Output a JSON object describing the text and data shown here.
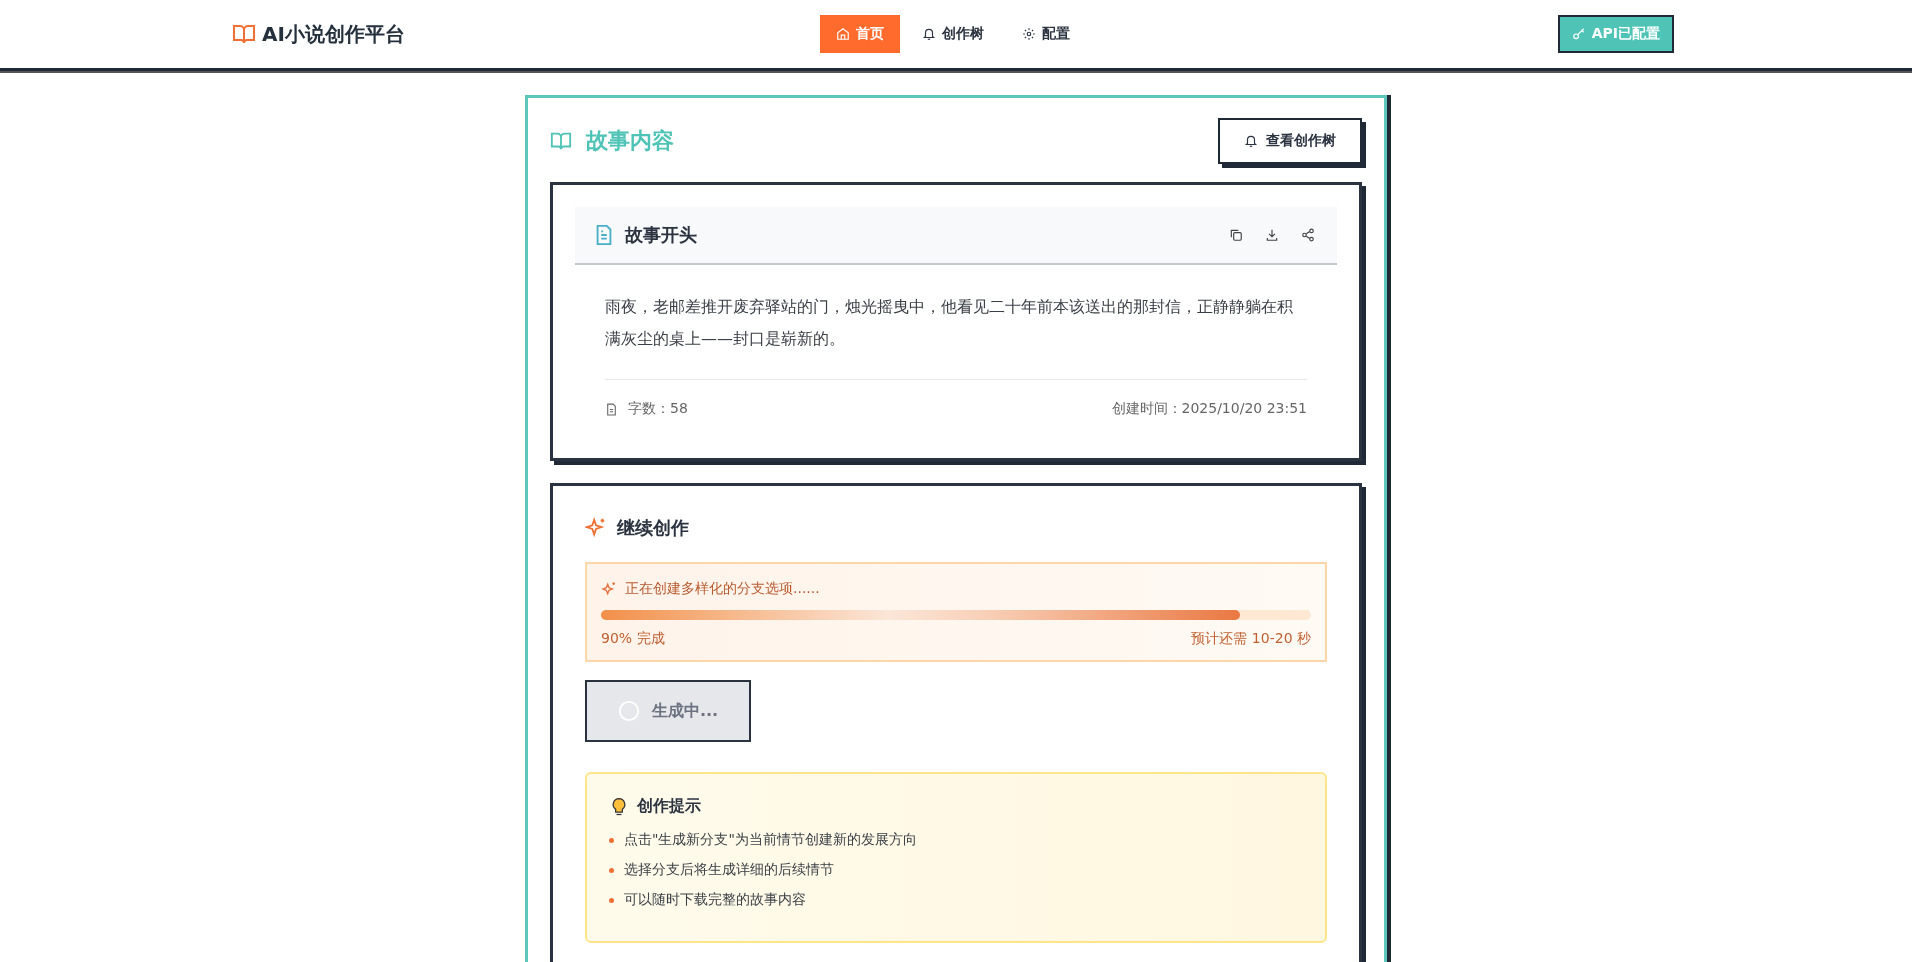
{
  "header": {
    "logo": "AI小说创作平台",
    "nav": [
      {
        "label": "首页",
        "selected": true
      },
      {
        "label": "创作树",
        "selected": false
      },
      {
        "label": "配置",
        "selected": false
      }
    ],
    "api_button": "API已配置"
  },
  "story": {
    "title": "故事内容",
    "tree_button": "查看创作树",
    "section_title": "故事开头",
    "text": "雨夜，老邮差推开废弃驿站的门，烛光摇曳中，他看见二十年前本该送出的那封信，正静静躺在积满灰尘的桌上——封口是崭新的。",
    "word_count": "字数：58",
    "created": "创建时间：2025/10/20 23:51"
  },
  "continue": {
    "title": "继续创作",
    "progress": {
      "message": "正在创建多样化的分支选项......",
      "level": 0.9,
      "percent": "90% 完成",
      "eta": "预计还需 10-20 秒"
    },
    "generate_button": {
      "label": "生成中...",
      "disabled": true
    },
    "tips": {
      "title": "创作提示",
      "items": [
        "点击\"生成新分支\"为当前情节创建新的发展方向",
        "选择分支后将生成详细的后续情节",
        "可以随时下载完整的故事内容"
      ]
    }
  }
}
